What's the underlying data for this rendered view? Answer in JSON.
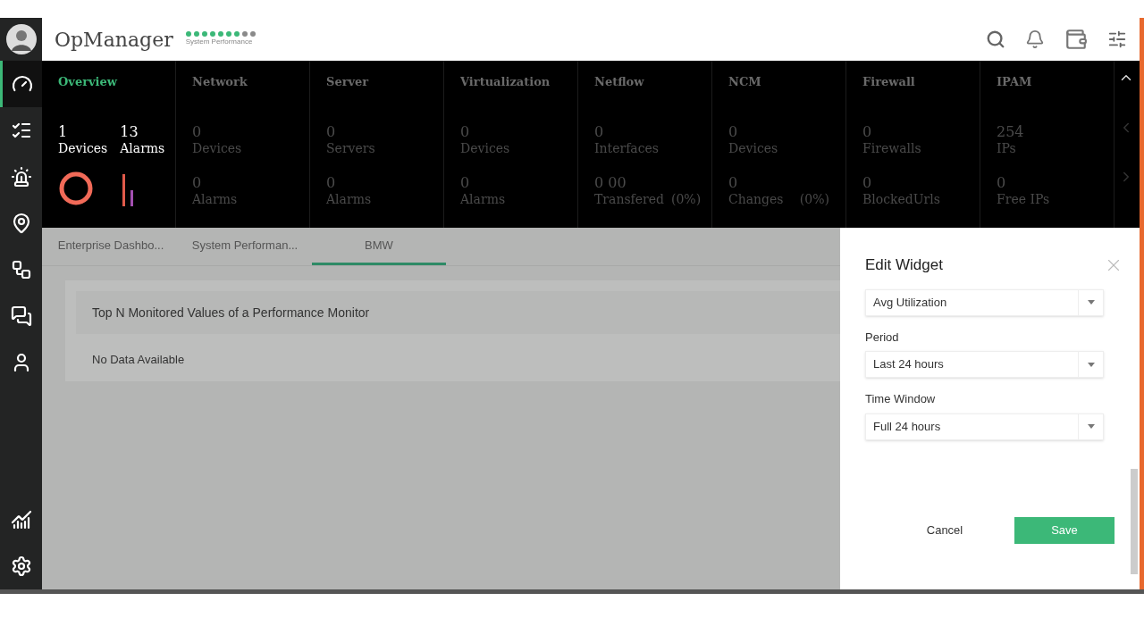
{
  "app": {
    "name": "OpManager",
    "subtitle": "System Performance"
  },
  "status_dots": [
    {
      "color": "#3cb878"
    },
    {
      "color": "#3cb878"
    },
    {
      "color": "#3cb878"
    },
    {
      "color": "#3cb878"
    },
    {
      "color": "#3cb878"
    },
    {
      "color": "#3cb878"
    },
    {
      "color": "#3cb878"
    },
    {
      "color": "#8a8a8a"
    },
    {
      "color": "#8a8a8a"
    }
  ],
  "sidebar": {
    "items": [
      {
        "kind": "dashboard",
        "selected": true
      },
      {
        "kind": "tasks",
        "selected": false
      },
      {
        "kind": "alarms",
        "selected": false
      },
      {
        "kind": "map",
        "selected": false
      },
      {
        "kind": "workflow",
        "selected": false
      },
      {
        "kind": "chat",
        "selected": false
      },
      {
        "kind": "user",
        "selected": false
      },
      {
        "kind": "reports",
        "selected": false
      },
      {
        "kind": "settings",
        "selected": false
      }
    ]
  },
  "summary": [
    {
      "kind": "overview",
      "title": "Overview",
      "selected": true,
      "stats": [
        {
          "value": "1",
          "label": "Devices"
        },
        {
          "value": "13",
          "label": "Alarms"
        }
      ]
    },
    {
      "kind": "module",
      "title": "Network",
      "selected": false,
      "stats": [
        {
          "value": "0",
          "label": "Devices"
        },
        {
          "value": "0",
          "label": "Alarms"
        }
      ]
    },
    {
      "kind": "module",
      "title": "Server",
      "selected": false,
      "stats": [
        {
          "value": "0",
          "label": "Servers"
        },
        {
          "value": "0",
          "label": "Alarms"
        }
      ]
    },
    {
      "kind": "module",
      "title": "Virtualization",
      "selected": false,
      "stats": [
        {
          "value": "0",
          "label": "Devices"
        },
        {
          "value": "0",
          "label": "Alarms"
        }
      ]
    },
    {
      "kind": "module",
      "title": "Netflow",
      "selected": false,
      "stats": [
        {
          "value": "0",
          "label": "Interfaces"
        },
        {
          "value": "0 00",
          "label": "Transfered",
          "percent": "(0%)"
        }
      ]
    },
    {
      "kind": "module",
      "title": "NCM",
      "selected": false,
      "stats": [
        {
          "value": "0",
          "label": "Devices"
        },
        {
          "value": "0",
          "label": "Changes",
          "percent": "(0%)"
        }
      ]
    },
    {
      "kind": "module",
      "title": "Firewall",
      "selected": false,
      "stats": [
        {
          "value": "0",
          "label": "Firewalls"
        },
        {
          "value": "0",
          "label": "BlockedUrls"
        }
      ]
    },
    {
      "kind": "module",
      "title": "IPAM",
      "selected": false,
      "stats": [
        {
          "value": "254",
          "label": "IPs"
        },
        {
          "value": "0",
          "label": "Free IPs"
        }
      ]
    }
  ],
  "tabs": [
    {
      "label": "Enterprise Dashbo...",
      "selected": false
    },
    {
      "label": "System Performan...",
      "selected": false
    },
    {
      "label": "BMW",
      "selected": true
    }
  ],
  "widget": {
    "title": "Top N Monitored Values of a Performance Monitor",
    "message": "No Data Available"
  },
  "panel": {
    "title": "Edit Widget",
    "fields": [
      {
        "value": "Avg Utilization"
      },
      {
        "label": "Period",
        "value": "Last 24 hours"
      },
      {
        "label": "Time Window",
        "value": "Full 24 hours"
      }
    ],
    "buttons": [
      {
        "kind": "secondary",
        "label": "Cancel"
      },
      {
        "kind": "primary",
        "label": "Save"
      }
    ]
  }
}
